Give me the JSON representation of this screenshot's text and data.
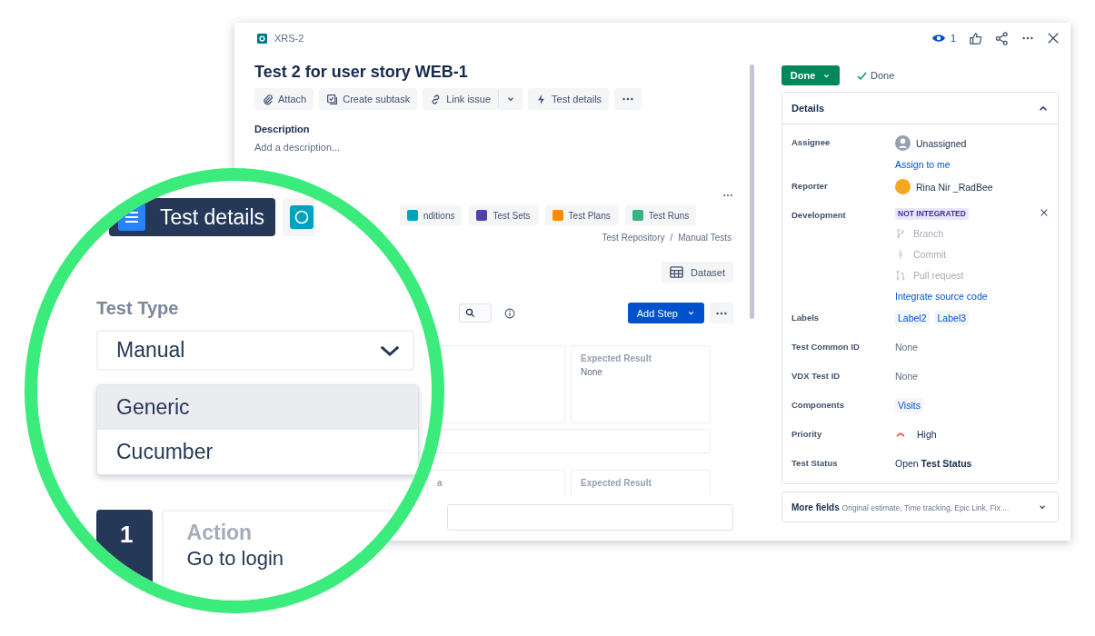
{
  "issue": {
    "key": "XRS-2",
    "watchers": "1",
    "title": "Test 2 for user story WEB-1",
    "toolbar": [
      {
        "kind": "attach",
        "label": "Attach"
      },
      {
        "kind": "subtask",
        "label": "Create subtask"
      },
      {
        "kind": "link",
        "label": "Link issue"
      },
      {
        "kind": "dropdown"
      },
      {
        "kind": "test",
        "label": "Test details"
      },
      {
        "kind": "more"
      }
    ],
    "description_label": "Description",
    "description_placeholder": "Add a description..."
  },
  "test_tabs": [
    {
      "label": "nditions",
      "color": "#00a3bf"
    },
    {
      "label": "Test Sets",
      "color": "#5243aa"
    },
    {
      "label": "Test Plans",
      "color": "#ff8b00"
    },
    {
      "label": "Test Runs",
      "color": "#36b37e"
    }
  ],
  "breadcrumb": [
    "Test Repository",
    "/",
    "Manual Tests"
  ],
  "dataset_button": "Dataset",
  "add_step_button": "Add Step",
  "steps": [
    {
      "expected_heading": "Expected Result",
      "expected": "None"
    },
    {
      "data_heading": "a",
      "expected_heading": "Expected Result"
    }
  ],
  "status": {
    "button": "Done",
    "resolution": "Done"
  },
  "details": {
    "title": "Details",
    "expanded": true,
    "fields": [
      {
        "kind": "assignee",
        "label": "Assignee",
        "value": "Unassigned",
        "link": "Assign to me"
      },
      {
        "kind": "reporter",
        "label": "Reporter",
        "value": "Rina Nir _RadBee"
      },
      {
        "kind": "development",
        "label": "Development",
        "badge": "NOT INTEGRATED",
        "items": [
          "Branch",
          "Commit",
          "Pull request"
        ],
        "link": "Integrate source code"
      },
      {
        "kind": "tags",
        "label": "Labels",
        "tags": [
          "Label2",
          "Label3"
        ]
      },
      {
        "kind": "text",
        "label": "Test Common ID",
        "value": "None"
      },
      {
        "kind": "text",
        "label": "VDX Test ID",
        "value": "None"
      },
      {
        "kind": "tags",
        "label": "Components",
        "tags": [
          "Visits"
        ]
      },
      {
        "kind": "priority",
        "label": "Priority",
        "value": "High"
      },
      {
        "kind": "rich",
        "label": "Test Status",
        "value": "Open **Test Status**"
      }
    ]
  },
  "more_fields": {
    "title": "More fields",
    "summary": "Original estimate, Time tracking, Epic Link, Fix ..."
  },
  "magnifier": {
    "tab": "Test details",
    "field_label": "Test Type",
    "value": "Manual",
    "options": [
      {
        "label": "Generic",
        "selected": true
      },
      {
        "label": "Cucumber",
        "selected": false
      }
    ],
    "step_number": "1",
    "step_heading": "Action",
    "step_text": "Go to login"
  }
}
